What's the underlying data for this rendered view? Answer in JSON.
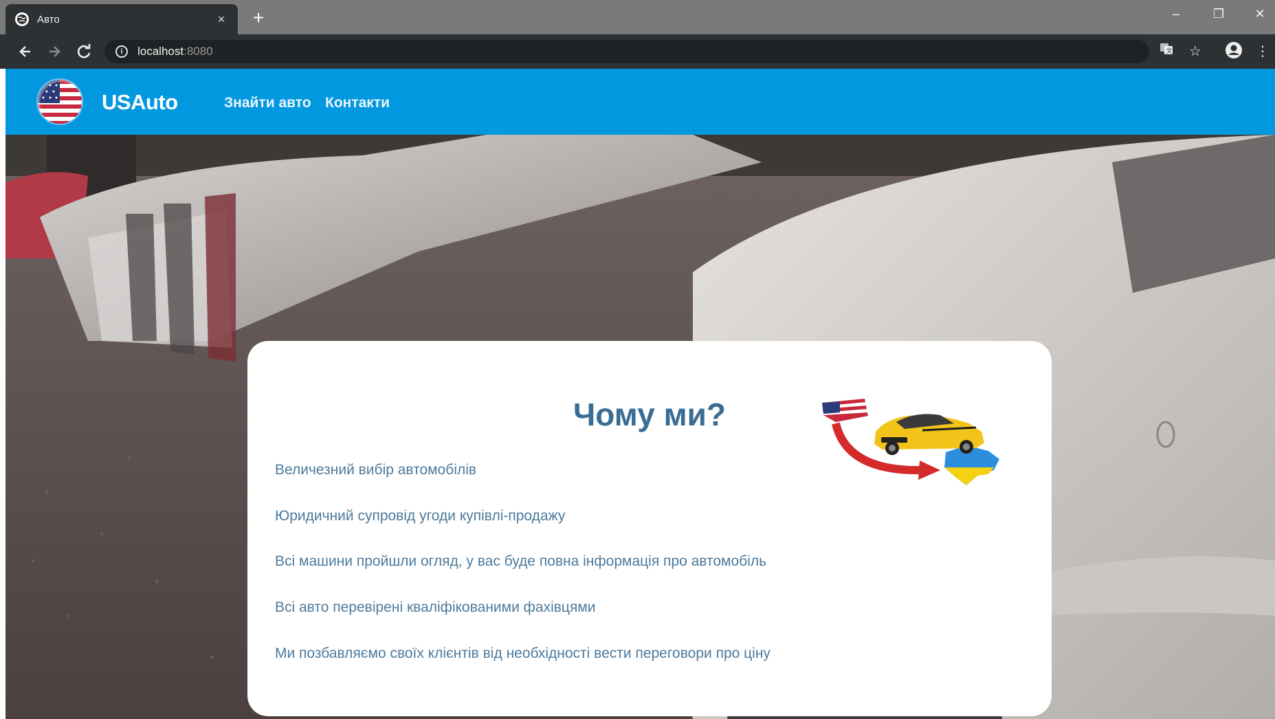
{
  "browser": {
    "tab_title": "Авто",
    "tab_close": "×",
    "new_tab": "+",
    "url_host": "localhost",
    "url_port": ":8080",
    "controls": {
      "minimize": "–",
      "restore": "❐",
      "close": "✕"
    }
  },
  "site": {
    "brand": "USAuto",
    "nav": [
      {
        "label": "Знайти авто"
      },
      {
        "label": "Контакти"
      }
    ],
    "logo_icon": "usa-flag-globe-icon"
  },
  "card": {
    "title": "Чому ми?",
    "graphic_icon": "usa-to-ukraine-car-illustration",
    "features": [
      "Величезний вибір автомобілів",
      "Юридичний супровід угоди купівлі-продажу",
      "Всі машини пройшли огляд, у вас буде повна інформація про автомобіль",
      "Всі авто перевірені кваліфікованими фахівцями",
      "Ми позбавляємо своїх клієнтів від необхідності вести переговори про ціну"
    ]
  },
  "colors": {
    "header_blue": "#0298e0",
    "title_blue": "#3a6d94",
    "text_blue": "#4d7a9c",
    "chrome_dark": "#2e3133"
  }
}
